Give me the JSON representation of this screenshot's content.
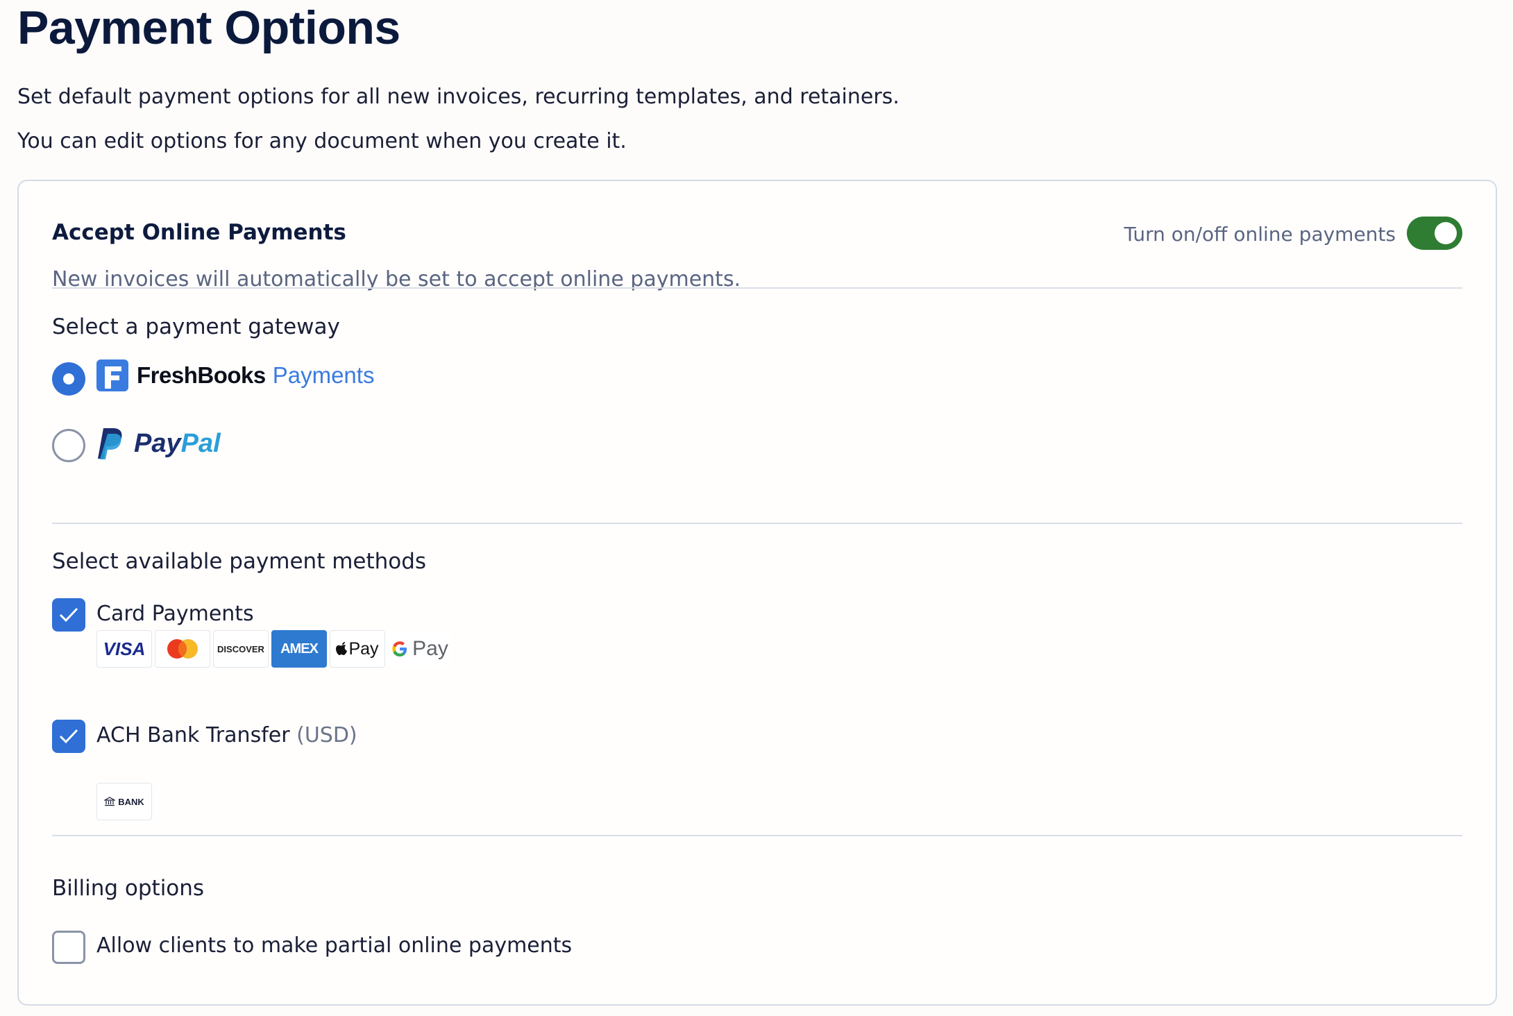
{
  "page": {
    "title": "Payment Options",
    "intro_line1": "Set default payment options for all new invoices, recurring templates, and retainers.",
    "intro_line2": "You can edit options for any document when you create it."
  },
  "online_payments": {
    "title": "Accept Online Payments",
    "subtitle": "New invoices will automatically be set to accept online payments.",
    "toggle_label": "Turn on/off online payments",
    "toggle_on": true,
    "toggle_color": "#2e7d32"
  },
  "gateway": {
    "heading": "Select a payment gateway",
    "options": [
      {
        "brand": "FreshBooks",
        "suffix": "Payments",
        "selected": true,
        "icon": "freshbooks-logo"
      },
      {
        "brand": "PayPal",
        "brand_part1": "Pay",
        "brand_part2": "Pal",
        "selected": false,
        "icon": "paypal-logo"
      }
    ]
  },
  "methods": {
    "heading": "Select available payment methods",
    "card": {
      "label": "Card Payments",
      "checked": true,
      "brands": [
        "VISA",
        "mastercard",
        "DISCOVER",
        "AMEX",
        "Pay",
        "Pay"
      ]
    },
    "ach": {
      "label": "ACH Bank Transfer",
      "currency": "(USD)",
      "checked": true,
      "badge": "BANK"
    }
  },
  "billing": {
    "heading": "Billing options",
    "partial_label": "Allow clients to make partial online payments",
    "partial_checked": false
  },
  "colors": {
    "accent": "#2f6fd6",
    "title": "#0b1a3c",
    "muted": "#5a6580"
  }
}
